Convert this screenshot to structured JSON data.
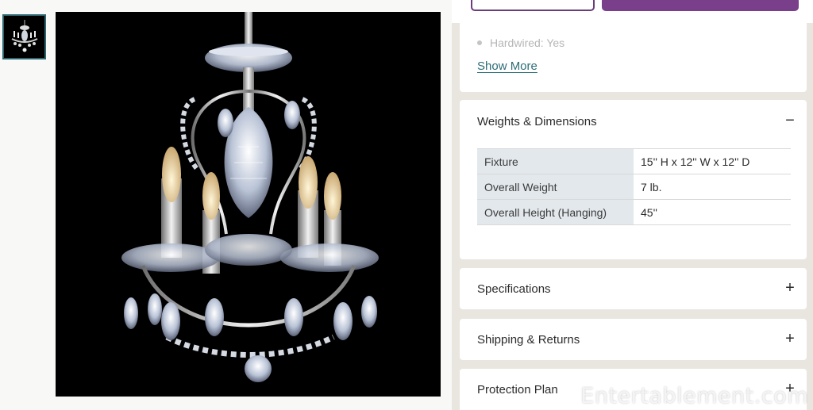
{
  "features": {
    "partial_line": "Hardwired: Yes",
    "show_more": "Show More"
  },
  "weights": {
    "title": "Weights & Dimensions",
    "toggle": "−",
    "rows": [
      {
        "label": "Fixture",
        "value": "15'' H x 12'' W x 12'' D"
      },
      {
        "label": "Overall Weight",
        "value": "7 lb."
      },
      {
        "label": "Overall Height (Hanging)",
        "value": "45''"
      }
    ]
  },
  "sections": [
    {
      "title": "Specifications",
      "toggle": "+"
    },
    {
      "title": "Shipping & Returns",
      "toggle": "+"
    },
    {
      "title": "Protection Plan",
      "toggle": "+"
    }
  ],
  "watermark": "Entertablement.com",
  "colors": {
    "accent": "#7a3f8a",
    "link": "#2b6d78",
    "table_key_bg": "#e3e8ec",
    "page_bg": "#e9e6e0"
  },
  "icons": {
    "expanded": "minus-icon",
    "collapsed": "plus-icon"
  }
}
